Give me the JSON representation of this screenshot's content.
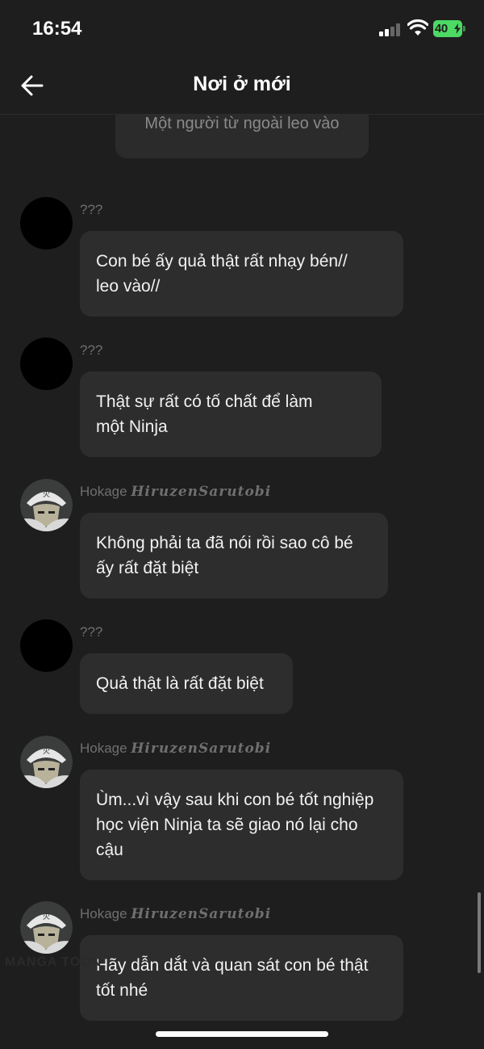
{
  "status_bar": {
    "time": "16:54",
    "battery": "40"
  },
  "header": {
    "title": "Nơi ở mới"
  },
  "system_message": "Một người từ ngoài leo vào",
  "messages": [
    {
      "sender": "???",
      "sender_script": "",
      "avatar": "black-avatar",
      "lines": [
        "Con bé ấy quả thật rất nhạy bén//",
        "leo vào//"
      ]
    },
    {
      "sender": "???",
      "sender_script": "",
      "avatar": "black-avatar",
      "lines": [
        "Thật sự rất có tố chất để làm",
        "một Ninja"
      ]
    },
    {
      "sender": "Hokage",
      "sender_script": "HiruzenSarutobi",
      "avatar": "hokage-avatar",
      "lines": [
        "Không phải ta đã nói rồi sao cô bé",
        "ấy rất đặt biệt"
      ]
    },
    {
      "sender": "???",
      "sender_script": "",
      "avatar": "black-avatar",
      "lines": [
        "Quả thật là rất đặt biệt"
      ]
    },
    {
      "sender": "Hokage",
      "sender_script": "HiruzenSarutobi",
      "avatar": "hokage-avatar",
      "lines": [
        "Ùm...vì vậy sau khi con bé tốt nghiệp",
        "học viện Ninja ta sẽ giao nó lại cho",
        "cậu"
      ]
    },
    {
      "sender": "Hokage",
      "sender_script": "HiruzenSarutobi",
      "avatar": "hokage-avatar",
      "lines": [
        "Hãy dẫn dắt và quan sát con bé thật",
        "tốt nhé"
      ]
    }
  ],
  "watermark": "MANGA TOON",
  "colors": {
    "background": "#1e1e1e",
    "bubble": "#2d2d2d",
    "battery": "#4cd964",
    "muted_text": "#6f6f6f"
  }
}
